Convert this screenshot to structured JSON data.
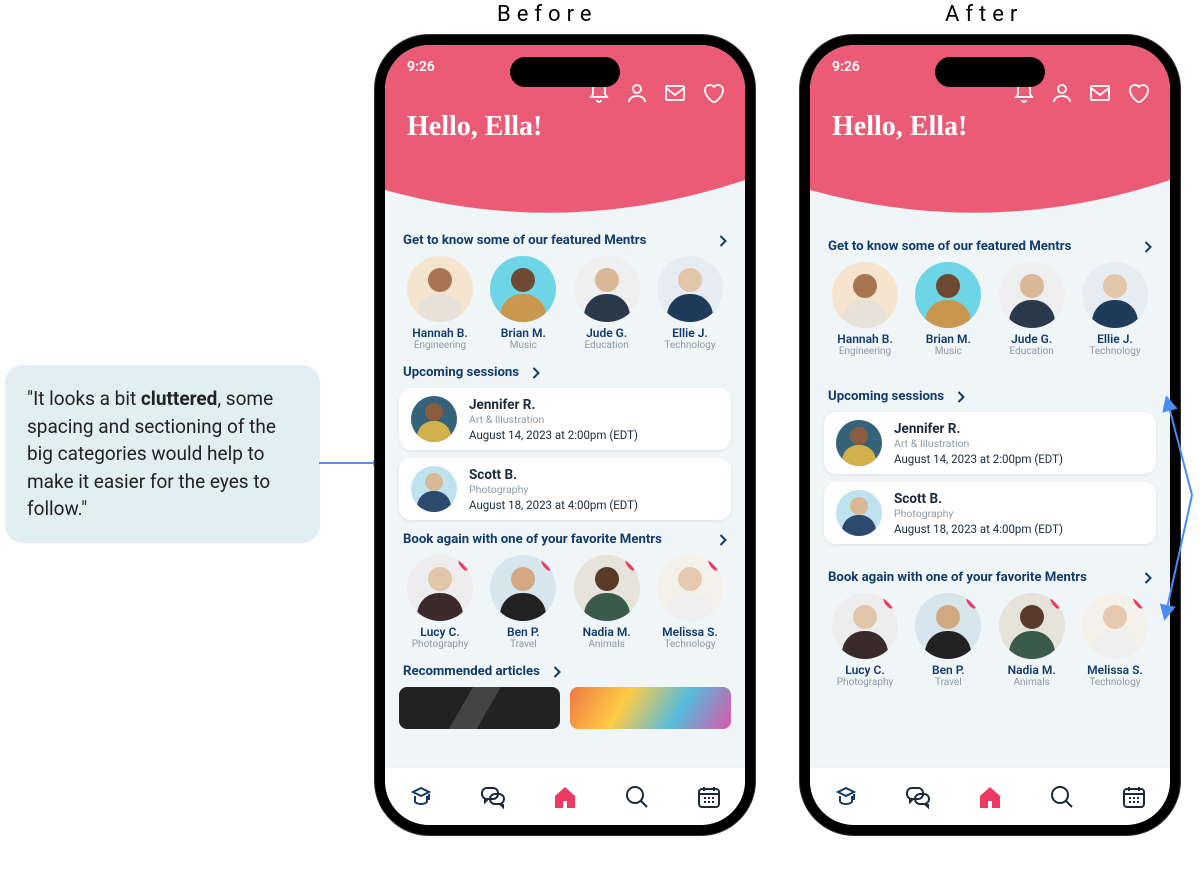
{
  "labels": {
    "before": "Before",
    "after": "After"
  },
  "callout": {
    "pre": "\"It looks a bit ",
    "bold": "cluttered",
    "post": ", some spacing and sectioning of the big categories would help to make it easier for the eyes to follow.\""
  },
  "status": {
    "time": "9:26"
  },
  "greeting": "Hello, Ella!",
  "sections": {
    "featured_title": "Get to know some of our featured Mentrs",
    "upcoming_title": "Upcoming sessions",
    "book_again_title": "Book again with one of your favorite Mentrs",
    "recommended_title": "Recommended articles"
  },
  "featured": [
    {
      "name": "Hannah B.",
      "field": "Engineering",
      "bg": "#f5e5cf",
      "skin": "#a87452",
      "cloth": "#e7e2d8"
    },
    {
      "name": "Brian M.",
      "field": "Music",
      "bg": "#6dd5e6",
      "skin": "#6e4a32",
      "cloth": "#c9974d"
    },
    {
      "name": "Jude G.",
      "field": "Education",
      "bg": "#efefef",
      "skin": "#d9b896",
      "cloth": "#2a3a4a"
    },
    {
      "name": "Ellie J.",
      "field": "Technology",
      "bg": "#e6edf2",
      "skin": "#e1c6a9",
      "cloth": "#1f3b5a"
    }
  ],
  "sessions": [
    {
      "name": "Jennifer R.",
      "field": "Art & Illustration",
      "time": "August 14, 2023 at 2:00pm (EDT)",
      "bg": "#35647a",
      "skin": "#8a5d3e",
      "cloth": "#d2b14a"
    },
    {
      "name": "Scott B.",
      "field": "Photography",
      "time": "August 18, 2023 at 4:00pm (EDT)",
      "bg": "#bfe2ef",
      "skin": "#d9b896",
      "cloth": "#2c4a6e"
    }
  ],
  "favorites": [
    {
      "name": "Lucy C.",
      "field": "Photography",
      "bg": "#ededed",
      "skin": "#e1c6a9",
      "cloth": "#3a2a2a"
    },
    {
      "name": "Ben P.",
      "field": "Travel",
      "bg": "#d6e6ec",
      "skin": "#d1a882",
      "cloth": "#222"
    },
    {
      "name": "Nadia M.",
      "field": "Animals",
      "bg": "#e6e3da",
      "skin": "#5a3a28",
      "cloth": "#3a5a4a"
    },
    {
      "name": "Melissa S.",
      "field": "Technology",
      "bg": "#f4f0ea",
      "skin": "#e6caaf",
      "cloth": "#efefef"
    }
  ],
  "colors": {
    "accent": "#ec5b75",
    "navy": "#123a6b",
    "heart": "#ec3a62"
  }
}
